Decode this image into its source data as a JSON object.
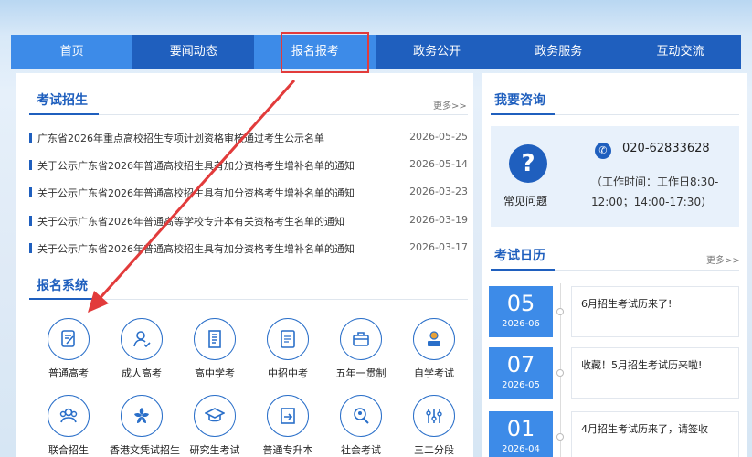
{
  "nav": {
    "items": [
      "首页",
      "要闻动态",
      "报名报考",
      "政务公开",
      "政务服务",
      "互动交流"
    ]
  },
  "exam": {
    "title": "考试招生",
    "more": "更多>>",
    "news": [
      {
        "title": "广东省2026年重点高校招生专项计划资格审核通过考生公示名单",
        "date": "2026-05-25"
      },
      {
        "title": "关于公示广东省2026年普通高校招生具有加分资格考生增补名单的通知",
        "date": "2026-05-14"
      },
      {
        "title": "关于公示广东省2026年普通高校招生具有加分资格考生增补名单的通知",
        "date": "2026-03-23"
      },
      {
        "title": "关于公示广东省2026年普通高等学校专升本有关资格考生名单的通知",
        "date": "2026-03-19"
      },
      {
        "title": "关于公示广东省2026年普通高校招生具有加分资格考生增补名单的通知",
        "date": "2026-03-17"
      }
    ]
  },
  "reg": {
    "title": "报名系统",
    "items": [
      {
        "label": "普通高考",
        "icon": "exam-paper-icon"
      },
      {
        "label": "成人高考",
        "icon": "adult-user-icon"
      },
      {
        "label": "高中学考",
        "icon": "notebook-icon"
      },
      {
        "label": "中招中考",
        "icon": "answer-sheet-icon"
      },
      {
        "label": "五年一贯制",
        "icon": "briefcase-icon"
      },
      {
        "label": "自学考试",
        "icon": "self-study-icon"
      },
      {
        "label": "联合招生",
        "icon": "group-icon"
      },
      {
        "label": "香港文凭试招生",
        "icon": "bauhinia-icon"
      },
      {
        "label": "研究生考试",
        "icon": "graduation-cap-icon"
      },
      {
        "label": "普通专升本",
        "icon": "upgrade-icon"
      },
      {
        "label": "社会考试",
        "icon": "id-person-icon"
      },
      {
        "label": "三二分段",
        "icon": "sliders-icon"
      }
    ]
  },
  "consult": {
    "title": "我要咨询",
    "faq_symbol": "?",
    "faq_label": "常见问题",
    "phone_symbol": "✆",
    "phone": "020-62833628",
    "hours": "（工作时间：工作日8:30-12:00；14:00-17:30）"
  },
  "calendar": {
    "title": "考试日历",
    "more": "更多>>",
    "entries": [
      {
        "day": "05",
        "ym": "2026-06",
        "text": "6月招生考试历来了!"
      },
      {
        "day": "07",
        "ym": "2026-05",
        "text": "收藏！5月招生考试历来啦!"
      },
      {
        "day": "01",
        "ym": "2026-04",
        "text": "4月招生考试历来了，请签收"
      }
    ]
  },
  "colors": {
    "brand": "#1f5fbe",
    "nav_active": "#3d8be8",
    "highlight": "#e23b3b"
  }
}
